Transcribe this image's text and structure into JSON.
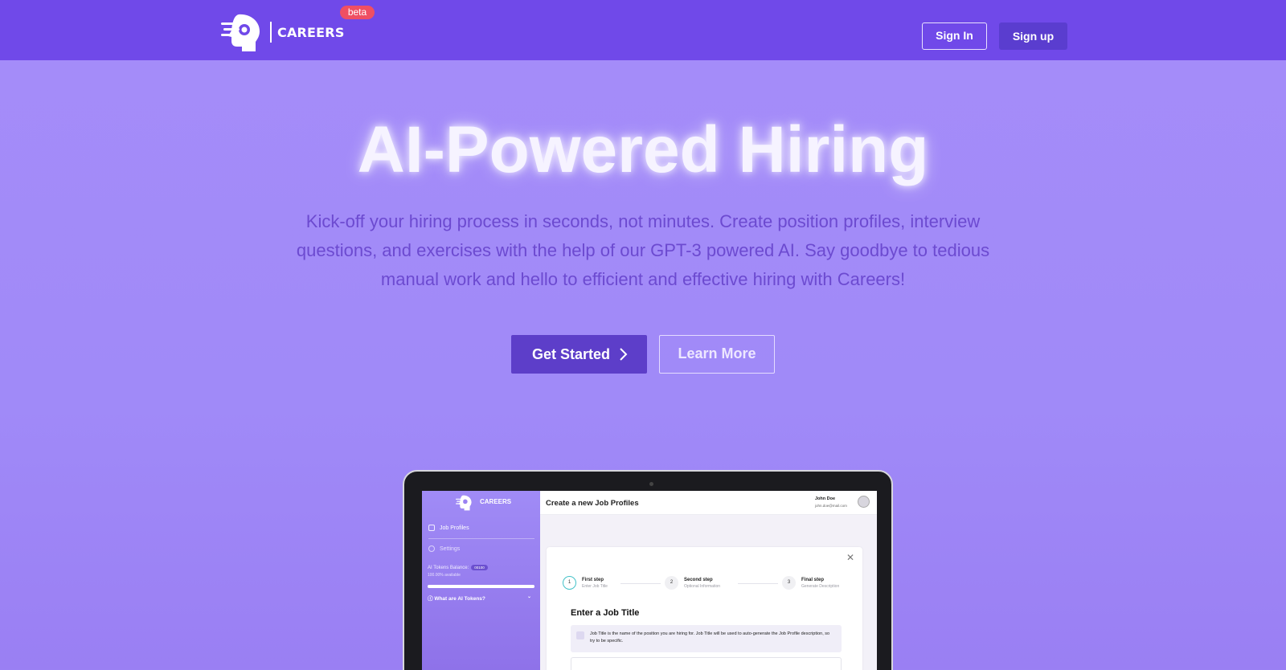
{
  "header": {
    "logo_text": "CAREERS",
    "beta_label": "beta",
    "sign_in_label": "Sign In",
    "sign_up_label": "Sign up"
  },
  "hero": {
    "title": "AI-Powered Hiring",
    "subtitle": "Kick-off your hiring process in seconds, not minutes. Create position profiles, interview questions, and exercises with the help of our GPT-3 powered AI. Say goodbye to tedious manual work and hello to efficient and effective hiring with Careers!",
    "get_started_label": "Get Started",
    "learn_more_label": "Learn More"
  },
  "mockup": {
    "sidebar": {
      "logo_text": "CAREERS",
      "items": [
        {
          "label": "Job Profiles",
          "icon": "document-icon"
        },
        {
          "label": "Settings",
          "icon": "gear-icon"
        }
      ],
      "tokens_label": "AI Tokens Balance:",
      "tokens_badge": "00100",
      "tokens_available": "100.00% available",
      "tokens_fraction": 1.0,
      "faq_label": "What are AI Tokens?"
    },
    "main": {
      "title": "Create a new Job Profiles",
      "user_name": "John Doe",
      "user_email": "john.doe@mail.com",
      "steps": [
        {
          "number": "1",
          "title": "First step",
          "subtitle": "Enter Job Title"
        },
        {
          "number": "2",
          "title": "Second step",
          "subtitle": "Optional Information"
        },
        {
          "number": "3",
          "title": "Final step",
          "subtitle": "Generate Description"
        }
      ],
      "card_heading": "Enter a Job Title",
      "info_text": "Job Title is the name of the position you are hiring for. Job Title will be used to auto-generate the Job Profile description, so try to be specific."
    }
  },
  "colors": {
    "header_bg": "#7049e9",
    "accent": "#5d3ec9",
    "beta_bg": "#ef4f63",
    "hero_bg": "#a58cf9"
  }
}
